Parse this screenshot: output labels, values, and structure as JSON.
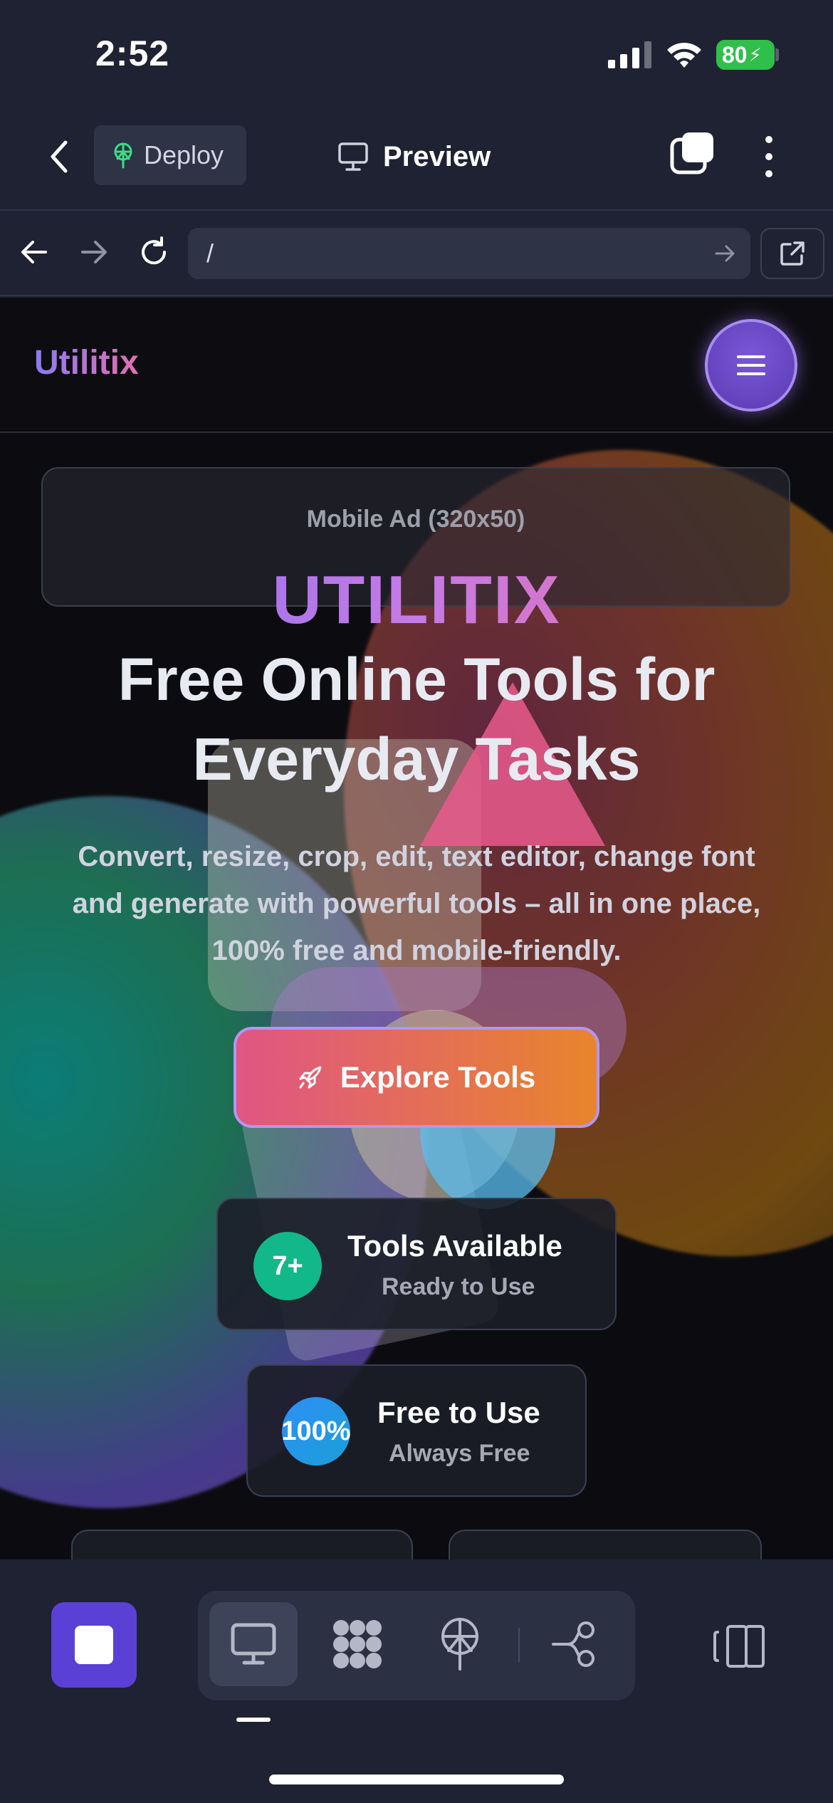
{
  "status_bar": {
    "time": "2:52",
    "battery": "80"
  },
  "toolbar": {
    "deploy_label": "Deploy",
    "preview_label": "Preview"
  },
  "browser": {
    "url": "/"
  },
  "site": {
    "logo": "Utilitix",
    "ad_label": "Mobile Ad (320x50)",
    "hero_brand": "UTILITIX",
    "hero_title": "Free Online Tools for Everyday Tasks",
    "hero_subtitle": "Convert, resize, crop, edit, text editor, change font and generate with powerful tools – all in one place, 100% free and mobile-friendly.",
    "cta_label": "Explore Tools",
    "stats": [
      {
        "badge": "7+",
        "title": "Tools Available",
        "subtitle": "Ready to Use"
      },
      {
        "badge": "100%",
        "title": "Free to Use",
        "subtitle": "Always Free"
      }
    ]
  },
  "colors": {
    "accent": "#5b40d6",
    "deploy_icon": "#3ddc84",
    "battery": "#2fbf4a"
  },
  "icons": [
    "back-icon",
    "deploy-icon",
    "monitor-icon",
    "tabs-icon",
    "more-icon",
    "arrow-left-icon",
    "arrow-right-icon",
    "reload-icon",
    "external-link-icon",
    "menu-icon",
    "rocket-icon",
    "stop-icon",
    "network-icon",
    "antenna-icon",
    "branch-icon",
    "panel-icon"
  ]
}
